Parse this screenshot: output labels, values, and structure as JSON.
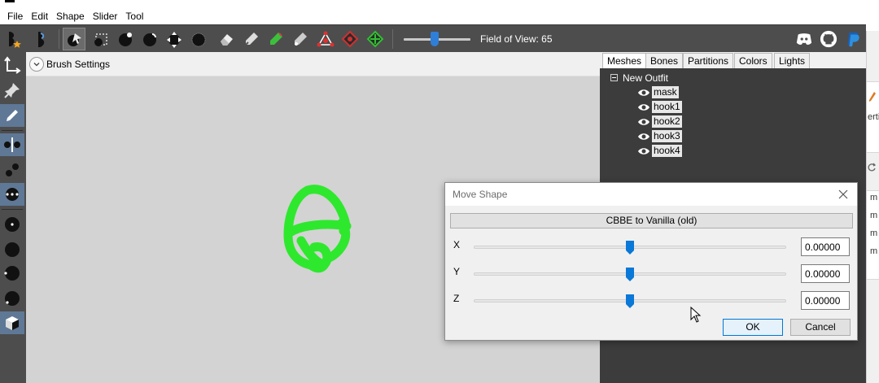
{
  "menu": [
    "File",
    "Edit",
    "Shape",
    "Slider",
    "Tool"
  ],
  "toolbar": {
    "fov_label": "Field of View: 65",
    "fov_value": 65,
    "brush_color": "#3cc03c",
    "brand_icons": [
      "discord-icon",
      "github-icon",
      "paypal-icon"
    ]
  },
  "viewport": {
    "brush_settings_label": "Brush Settings",
    "background_color": "#d3d3d3",
    "mesh_color": "#2ee82e"
  },
  "right_panel": {
    "tabs": [
      "Meshes",
      "Bones",
      "Partitions",
      "Colors",
      "Lights"
    ],
    "active_tab": "Meshes",
    "tree_root": "New Outfit",
    "meshes": [
      "mask",
      "hook1",
      "hook2",
      "hook3",
      "hook4"
    ]
  },
  "dialog": {
    "title": "Move Shape",
    "preset_button": "CBBE to Vanilla (old)",
    "axes": [
      {
        "label": "X",
        "value": "0.00000"
      },
      {
        "label": "Y",
        "value": "0.00000"
      },
      {
        "label": "Z",
        "value": "0.00000"
      }
    ],
    "slider_fraction": 0.5,
    "ok_label": "OK",
    "cancel_label": "Cancel"
  },
  "background_window": {
    "fragments": [
      "erti",
      "m",
      "m",
      "m",
      "m"
    ]
  }
}
